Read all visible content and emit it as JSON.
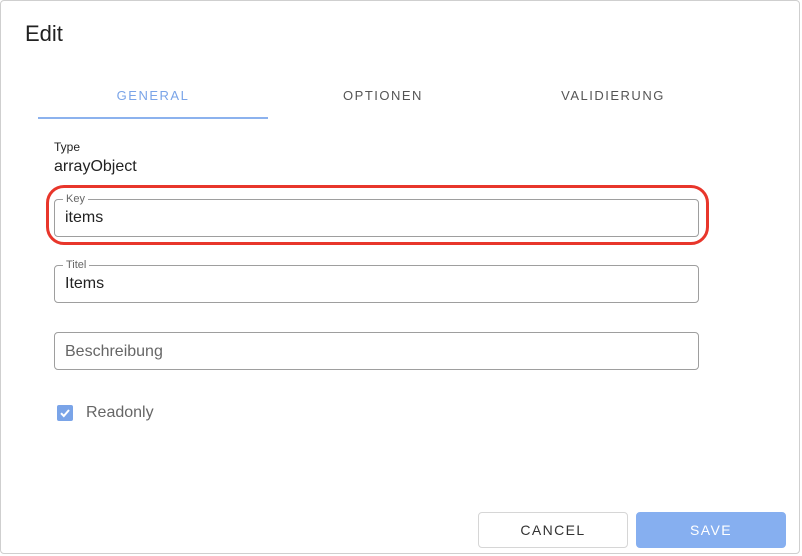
{
  "dialog": {
    "title": "Edit"
  },
  "tabs": [
    {
      "label": "GENERAL",
      "active": true
    },
    {
      "label": "OPTIONEN",
      "active": false
    },
    {
      "label": "VALIDIERUNG",
      "active": false
    }
  ],
  "type_field": {
    "label": "Type",
    "value": "arrayObject"
  },
  "key_field": {
    "label": "Key",
    "value": "items"
  },
  "titel_field": {
    "label": "Titel",
    "value": "Items"
  },
  "beschreibung_field": {
    "placeholder": "Beschreibung",
    "value": ""
  },
  "readonly": {
    "label": "Readonly",
    "checked": true
  },
  "buttons": {
    "cancel": "CANCEL",
    "save": "SAVE"
  },
  "colors": {
    "accent": "#7aa4e8",
    "highlight": "#e8362b",
    "save_button": "#86aff0"
  },
  "icons": {
    "checkbox": "check-icon"
  }
}
